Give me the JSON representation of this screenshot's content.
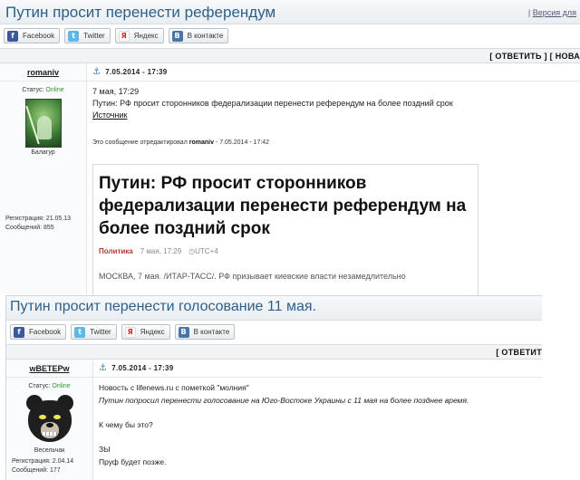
{
  "shot1": {
    "title": "Путин просит перенести референдум",
    "version_link": "Версия для",
    "share": [
      "Facebook",
      "Twitter",
      "Яндекс",
      "В контакте"
    ],
    "actions": "[ ОТВЕТИТЬ ]  [ НОВА",
    "post": {
      "username": "romaniv",
      "datetime": "7.05.2014 - 17:39",
      "status_label": "Статус:",
      "status_value": "Online",
      "rank": "Балагур",
      "reg_date": "Регистрация: 21.05.13",
      "messages": "Сообщений: 855",
      "line1": "7 мая, 17:29",
      "line2": "Путин: РФ просит сторонников федерализации перенести референдум на более поздний срок",
      "source": "Источник",
      "edited_prefix": "Это сообщение отредактировал",
      "edited_user": "romaniv",
      "edited_date": "- 7.05.2014 - 17:42",
      "quote": {
        "headline": "Путин: РФ просит сторонников федерализации перенести референдум на более поздний срок",
        "category": "Политика",
        "time": "7 мая, 17:29",
        "tz": "UTC+4",
        "lead": "МОСКВА, 7 мая. /ИТАР-ТАСС/. РФ призывает киевские власти незамедлительно"
      }
    }
  },
  "shot2": {
    "title": "Путин просит перенести голосование 11 мая.",
    "share": [
      "Facebook",
      "Twitter",
      "Яндекс",
      "В контакте"
    ],
    "actions": "[ ОТВЕТИТ",
    "post": {
      "username": "wBETEPw",
      "datetime": "7.05.2014 - 17:39",
      "status_label": "Статус:",
      "status_value": "Online",
      "rank": "Весельчак",
      "reg_date": "Регистрация: 2.04.14",
      "messages": "Сообщений: 177",
      "line1": "Новость с lifenews.ru с пометкой \"молния\"",
      "line2": "Путин попросил перенести голосование на Юго-Востоке Украины с 11 мая на более позднее время.",
      "line3": "К чему бы это?",
      "line4": "ЗЫ",
      "line5": "Пруф будет позже."
    }
  },
  "icons": {
    "facebook": "f",
    "twitter": "t",
    "yandex": "Я",
    "vk": "B",
    "anchor": "⚓",
    "clock": "◷"
  }
}
